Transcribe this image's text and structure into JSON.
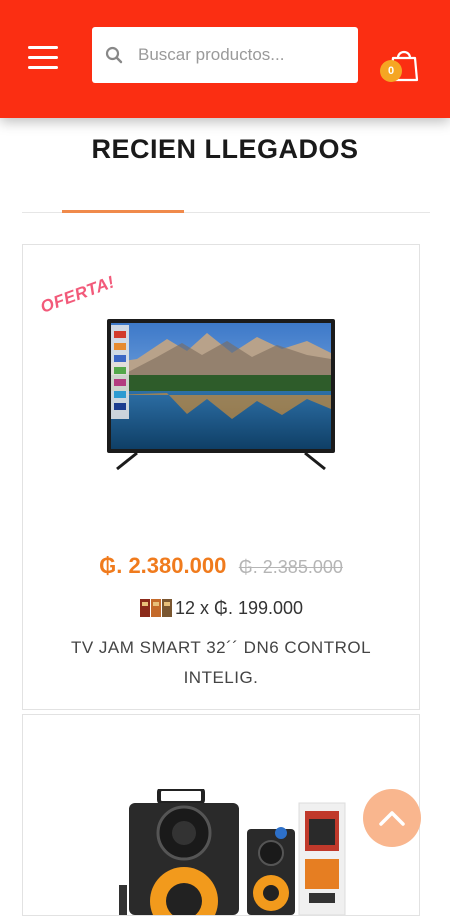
{
  "search": {
    "placeholder": "Buscar productos..."
  },
  "cart": {
    "count": "0"
  },
  "section": {
    "title": "RECIEN LLEGADOS"
  },
  "products": [
    {
      "badge": "OFERTA!",
      "price_current": "₲. 2.380.000",
      "price_old": "₲. 2.385.000",
      "installments": "12 x ₲. 199.000",
      "name": "TV JAM SMART 32´´ DN6 CONTROL INTELIG."
    }
  ],
  "icons": {
    "menu": "hamburger-icon",
    "search": "search-icon",
    "cart": "shopping-bag-icon",
    "scroll_top": "chevron-up-icon",
    "installments": "card-icon"
  },
  "colors": {
    "header": "#fb2e12",
    "price": "#f07b1d",
    "badge_cart": "#f5a623",
    "oferta": "#f25a7a",
    "scroll_button": "#f9b68e"
  }
}
